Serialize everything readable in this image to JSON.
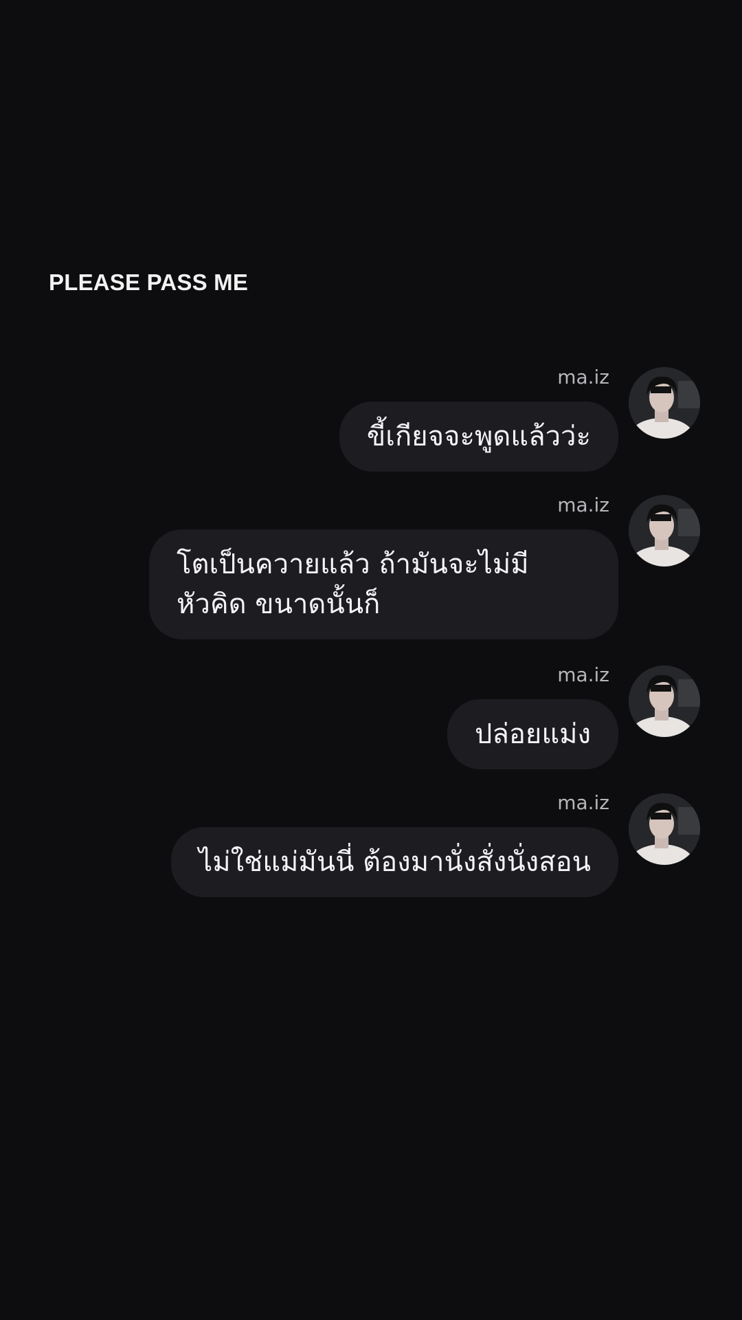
{
  "header": {
    "title": "PLEASE PASS ME"
  },
  "messages": [
    {
      "sender": "ma.iz",
      "text": "ขี้เกียจจะพูดแล้วว่ะ",
      "avatar_icon": "user-avatar-photo"
    },
    {
      "sender": "ma.iz",
      "text": "โตเป็นควายแล้ว ถ้ามันจะไม่มีหัวคิด ขนาดนั้นก็",
      "avatar_icon": "user-avatar-photo"
    },
    {
      "sender": "ma.iz",
      "text": "ปล่อยแม่ง",
      "avatar_icon": "user-avatar-photo"
    },
    {
      "sender": "ma.iz",
      "text": "ไม่ใช่แม่มันนี่ ต้องมานั่งสั่งนั่งสอน",
      "avatar_icon": "user-avatar-photo"
    }
  ],
  "colors": {
    "background": "#0d0d0f",
    "bubble": "#1c1c21",
    "text": "#f4f4f6",
    "sender": "#b6b6bb"
  }
}
